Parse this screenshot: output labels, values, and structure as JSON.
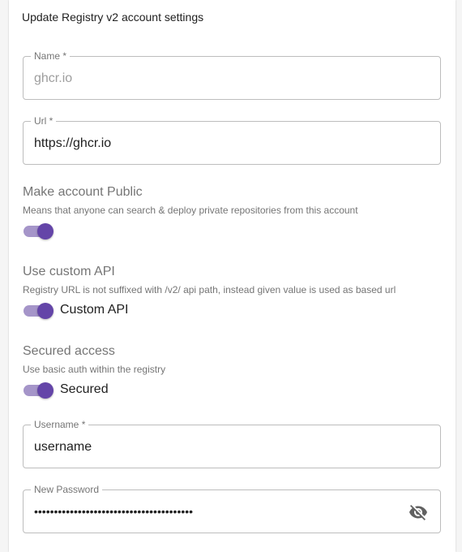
{
  "form": {
    "title": "Update Registry v2 account settings",
    "name": {
      "label": "Name *",
      "value": "ghcr.io"
    },
    "url": {
      "label": "Url *",
      "value": "https://ghcr.io"
    },
    "public": {
      "title": "Make account Public",
      "description": "Means that anyone can search & deploy private repositories from this account",
      "enabled": true
    },
    "custom_api": {
      "title": "Use custom API",
      "description": "Registry URL is not suffixed with /v2/ api path, instead given value is used as based url",
      "switch_label": "Custom API",
      "enabled": true
    },
    "secured": {
      "title": "Secured access",
      "description": "Use basic auth within the registry",
      "switch_label": "Secured",
      "enabled": true
    },
    "username": {
      "label": "Username *",
      "value": "username"
    },
    "password": {
      "label": "New Password",
      "value": "••••••••••••••••••••••••••••••••••••••••"
    }
  },
  "colors": {
    "accent": "#6445a8",
    "accent_track": "#a595c9"
  },
  "icons": {
    "password_toggle": "eye-off-icon"
  }
}
